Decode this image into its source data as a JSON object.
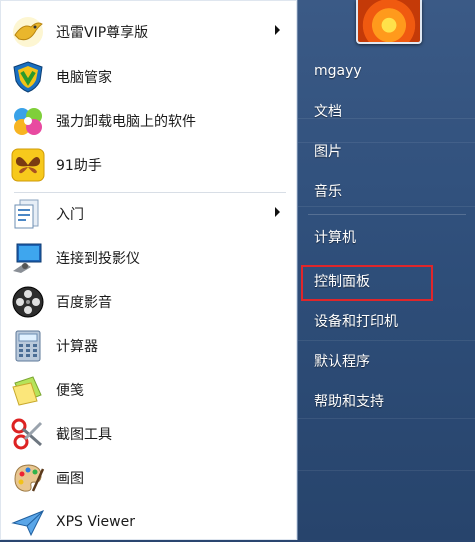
{
  "programs": [
    {
      "label": "迅雷VIP尊享版",
      "icon": "thunder-bird-icon",
      "has_submenu": true
    },
    {
      "label": "电脑管家",
      "icon": "shield-icon",
      "has_submenu": false
    },
    {
      "label": "强力卸载电脑上的软件",
      "icon": "clover-icon",
      "has_submenu": false
    },
    {
      "label": "91助手",
      "icon": "butterfly-icon",
      "has_submenu": false
    },
    {
      "label": "入门",
      "icon": "getting-started-icon",
      "has_submenu": true
    },
    {
      "label": "连接到投影仪",
      "icon": "projector-icon",
      "has_submenu": false
    },
    {
      "label": "百度影音",
      "icon": "film-reel-icon",
      "has_submenu": false
    },
    {
      "label": "计算器",
      "icon": "calculator-icon",
      "has_submenu": false
    },
    {
      "label": "便笺",
      "icon": "sticky-notes-icon",
      "has_submenu": false
    },
    {
      "label": "截图工具",
      "icon": "scissors-icon",
      "has_submenu": false
    },
    {
      "label": "画图",
      "icon": "paint-palette-icon",
      "has_submenu": false
    },
    {
      "label": "XPS Viewer",
      "icon": "xps-viewer-icon",
      "has_submenu": false
    }
  ],
  "right_panel": {
    "username": "mgayy",
    "items": [
      "文档",
      "图片",
      "音乐",
      "计算机",
      "控制面板",
      "设备和打印机",
      "默认程序",
      "帮助和支持"
    ],
    "highlighted_item": "控制面板",
    "highlight_color": "#e0262a"
  },
  "colors": {
    "right_panel_bg": "#30507c",
    "left_panel_bg": "#ffffff"
  }
}
